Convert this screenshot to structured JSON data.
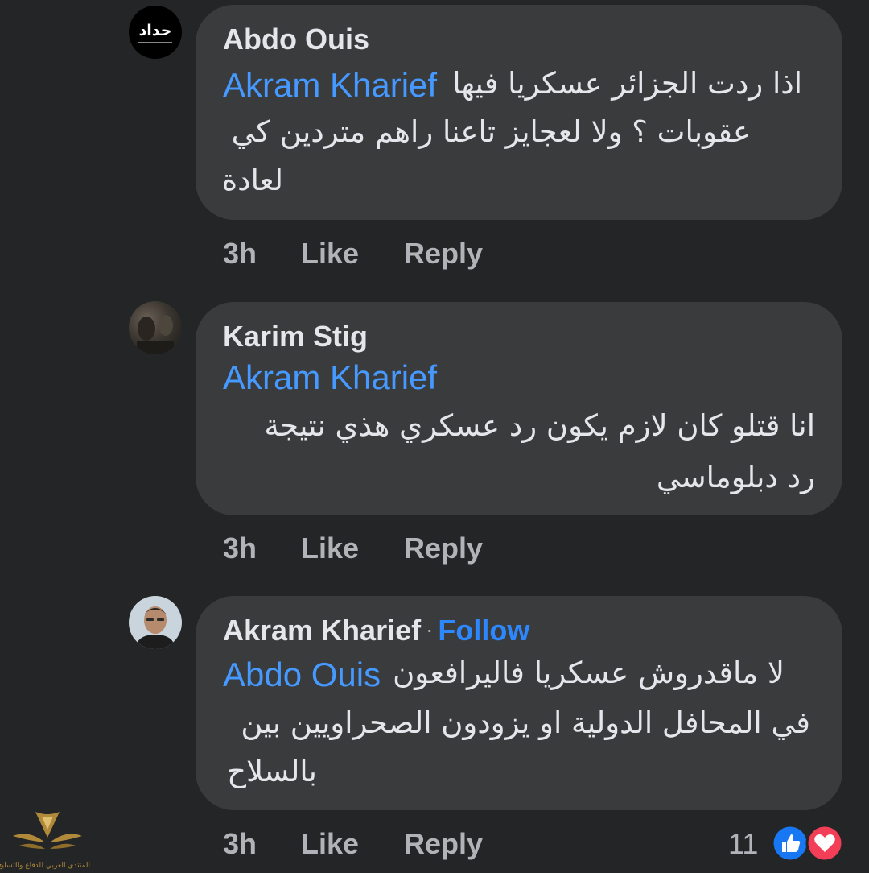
{
  "comments": [
    {
      "author": "Abdo Ouis",
      "mention": "Akram Kharief",
      "line1": "اذا ردت الجزائر عسكريا فيها",
      "line2": "عقوبات ؟ ولا لعجايز تاعنا راهم متردين كي",
      "line3": "لعادة",
      "time": "3h",
      "like": "Like",
      "reply": "Reply",
      "avatar_text": "حداد"
    },
    {
      "author": "Karim Stig",
      "mention": "Akram Kharief",
      "line1": "انا قتلو كان لازم يكون رد عسكري هذي نتيجة",
      "line2": "رد دبلوماسي",
      "time": "3h",
      "like": "Like",
      "reply": "Reply"
    },
    {
      "author": "Akram Kharief",
      "follow": "Follow",
      "mention": "Abdo Ouis",
      "line1": "لا ماقدروش عسكريا فاليرافعون",
      "line2": "في المحافل الدولية او يزودون الصحراويين بين",
      "line3": "بالسلاح",
      "time": "3h",
      "like": "Like",
      "reply": "Reply",
      "reaction_count": "11"
    }
  ],
  "watermark_text": "المنتدى العربي للدفاع والتسليح",
  "colors": {
    "background": "#242526",
    "bubble": "#3a3b3c",
    "link": "#4599ff",
    "like": "#1877f2",
    "love": "#f33e58"
  }
}
